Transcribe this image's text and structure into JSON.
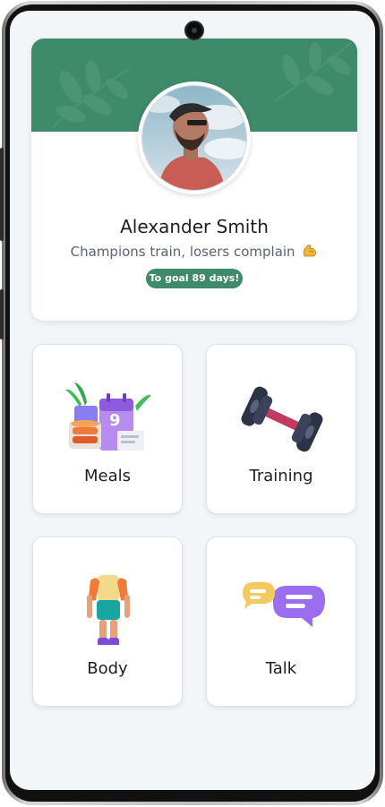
{
  "profile": {
    "name": "Alexander Smith",
    "tagline": "Champions train, losers complain",
    "badge": "To goal 89 days!"
  },
  "menu": {
    "meals": "Meals",
    "training": "Training",
    "body": "Body",
    "talk": "Talk"
  },
  "colors": {
    "accent": "#3f8a6a",
    "background": "#f3f6f9",
    "card": "#ffffff",
    "text": "#1c1f24",
    "muted": "#5b6470"
  },
  "icons": {
    "meals": "meals-calendar-icon",
    "training": "dumbbell-icon",
    "body": "body-figure-icon",
    "talk": "chat-bubbles-icon",
    "tagline_emoji": "flexed-biceps-icon"
  }
}
